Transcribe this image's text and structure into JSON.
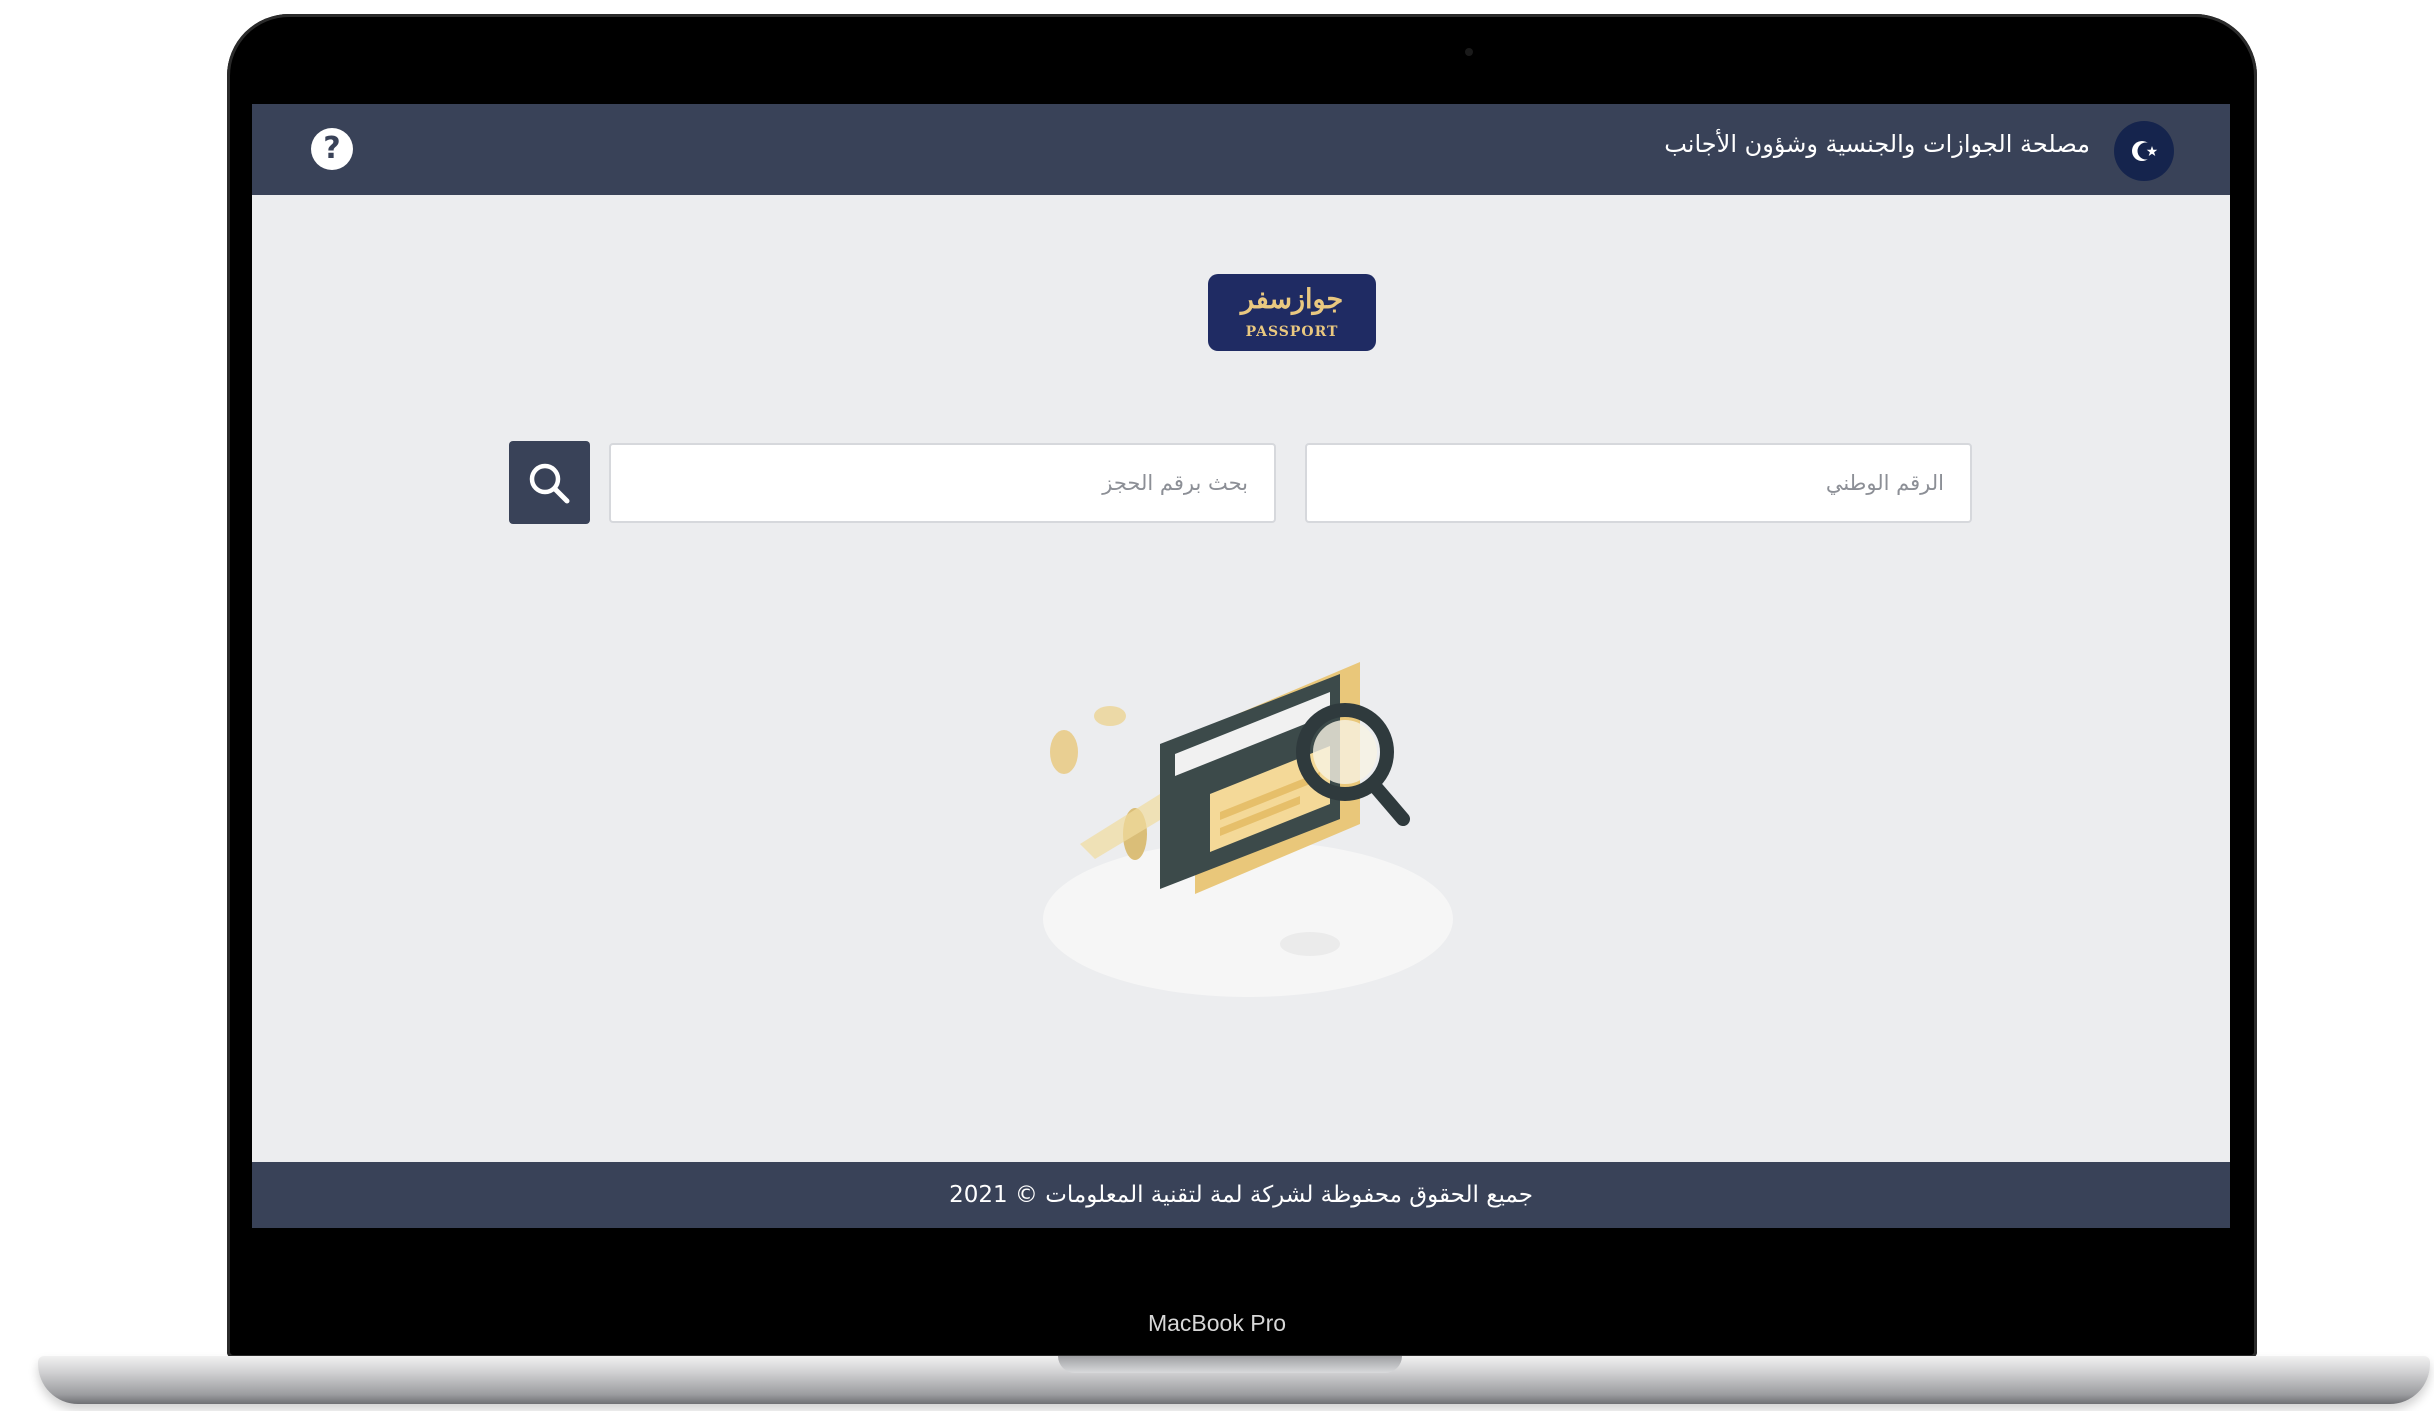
{
  "device": {
    "label": "MacBook Pro"
  },
  "header": {
    "title": "مصلحة الجوازات والجنسية وشؤون الأجانب",
    "help_icon": "question-circle-icon",
    "emblem_icon": "crescent-star-emblem-icon"
  },
  "logo": {
    "arabic": "جوازسفر",
    "english": "PASSPORT"
  },
  "search": {
    "national_id_placeholder": "الرقم الوطني",
    "booking_placeholder": "بحث برقم الحجز",
    "button_icon": "search-icon"
  },
  "illustration": {
    "icon": "document-search-illustration"
  },
  "footer": {
    "copyright": "جميع الحقوق محفوظة لشركة لمة لتقنية المعلومات © 2021"
  },
  "colors": {
    "header_bg": "#394258",
    "screen_bg": "#ecedef",
    "logo_bg": "#1f2b63",
    "logo_text": "#e9c880",
    "emblem_bg": "#15244d"
  }
}
